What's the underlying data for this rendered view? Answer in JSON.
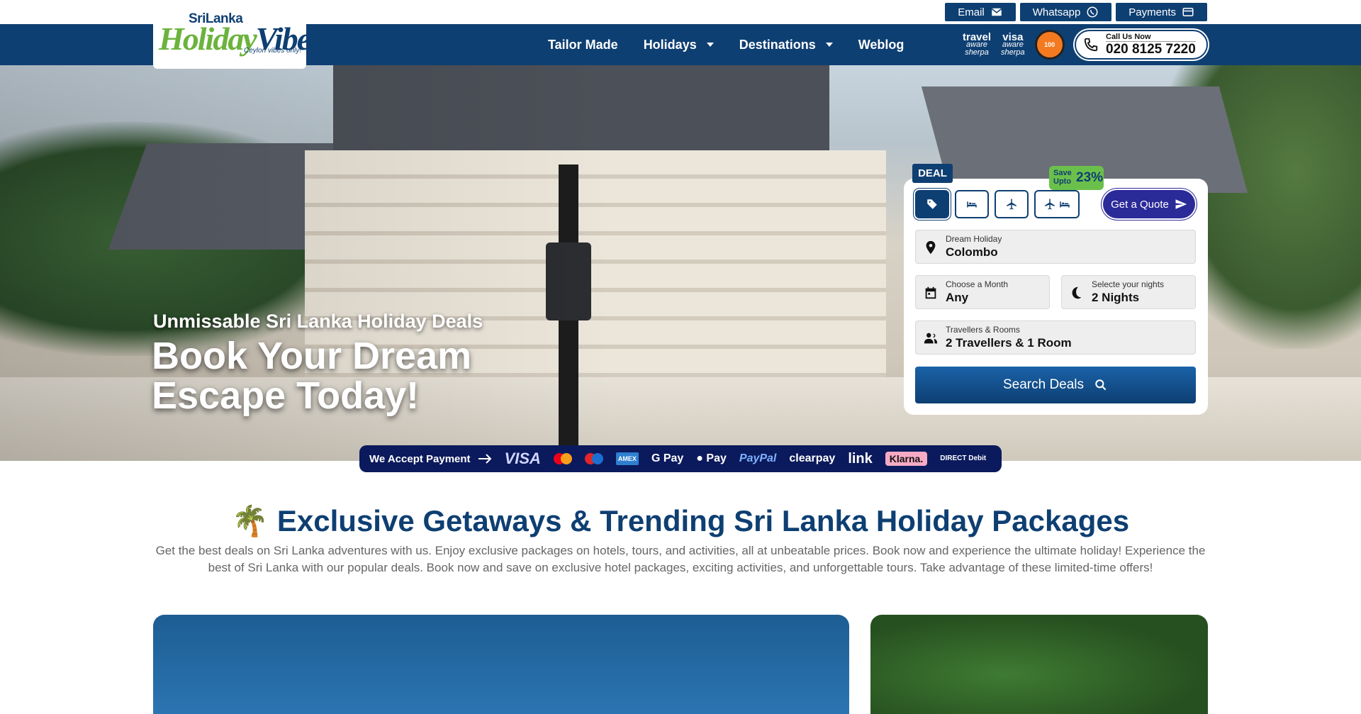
{
  "top_links": [
    {
      "label": "Email",
      "icon": "mail-icon"
    },
    {
      "label": "Whatsapp",
      "icon": "whatsapp-icon"
    },
    {
      "label": "Payments",
      "icon": "card-icon"
    }
  ],
  "logo": {
    "line1": "SriLanka",
    "word1": "Holiday",
    "word2": "Vibes",
    "tagline": "Ceylon vibes only!"
  },
  "nav": {
    "items": [
      "Tailor Made",
      "Holidays",
      "Destinations",
      "Weblog"
    ]
  },
  "badges": {
    "travel_aware": {
      "top": "travel",
      "mid": "aware",
      "bottom": "sherpa"
    },
    "visa_aware": {
      "top": "visa",
      "mid": "aware",
      "bottom": "sherpa"
    },
    "circle": "100"
  },
  "call": {
    "label": "Call Us Now",
    "number": "020 8125 7220"
  },
  "hero": {
    "subtitle": "Unmissable Sri Lanka Holiday Deals",
    "title": "Book Your Dream Escape Today!"
  },
  "search": {
    "deal_tag": "DEAL",
    "save_label": "Save Upto",
    "save_value": "23%",
    "quote_label": "Get a Quote",
    "fields": {
      "destination": {
        "label": "Dream Holiday",
        "value": "Colombo"
      },
      "month": {
        "label": "Choose a Month",
        "value": "Any"
      },
      "nights": {
        "label": "Selecte your nights",
        "value": "2 Nights"
      },
      "travellers": {
        "label": "Travellers & Rooms",
        "value": "2 Travellers & 1 Room"
      }
    },
    "button": "Search Deals"
  },
  "payment": {
    "label": "We Accept Payment",
    "methods": {
      "visa": "VISA",
      "amex": "AMEX",
      "gpay": "G Pay",
      "applepay": "Pay",
      "paypal": "PayPal",
      "clearpay": "clearpay",
      "link": "link",
      "klarna": "Klarna.",
      "directdebit": "DIRECT Debit"
    }
  },
  "section": {
    "title": "🌴 Exclusive Getaways & Trending Sri Lanka Holiday Packages",
    "description": "Get the best deals on Sri Lanka adventures with us. Enjoy exclusive packages on hotels, tours, and activities, all at unbeatable prices. Book now and experience the ultimate holiday! Experience the best of Sri Lanka with our popular deals. Book now and save on exclusive hotel packages, exciting activities, and unforgettable tours. Take advantage of these limited-time offers!"
  },
  "colors": {
    "brand": "#0e3f72",
    "accent": "#6bb33c",
    "quote": "#2b2a99"
  }
}
